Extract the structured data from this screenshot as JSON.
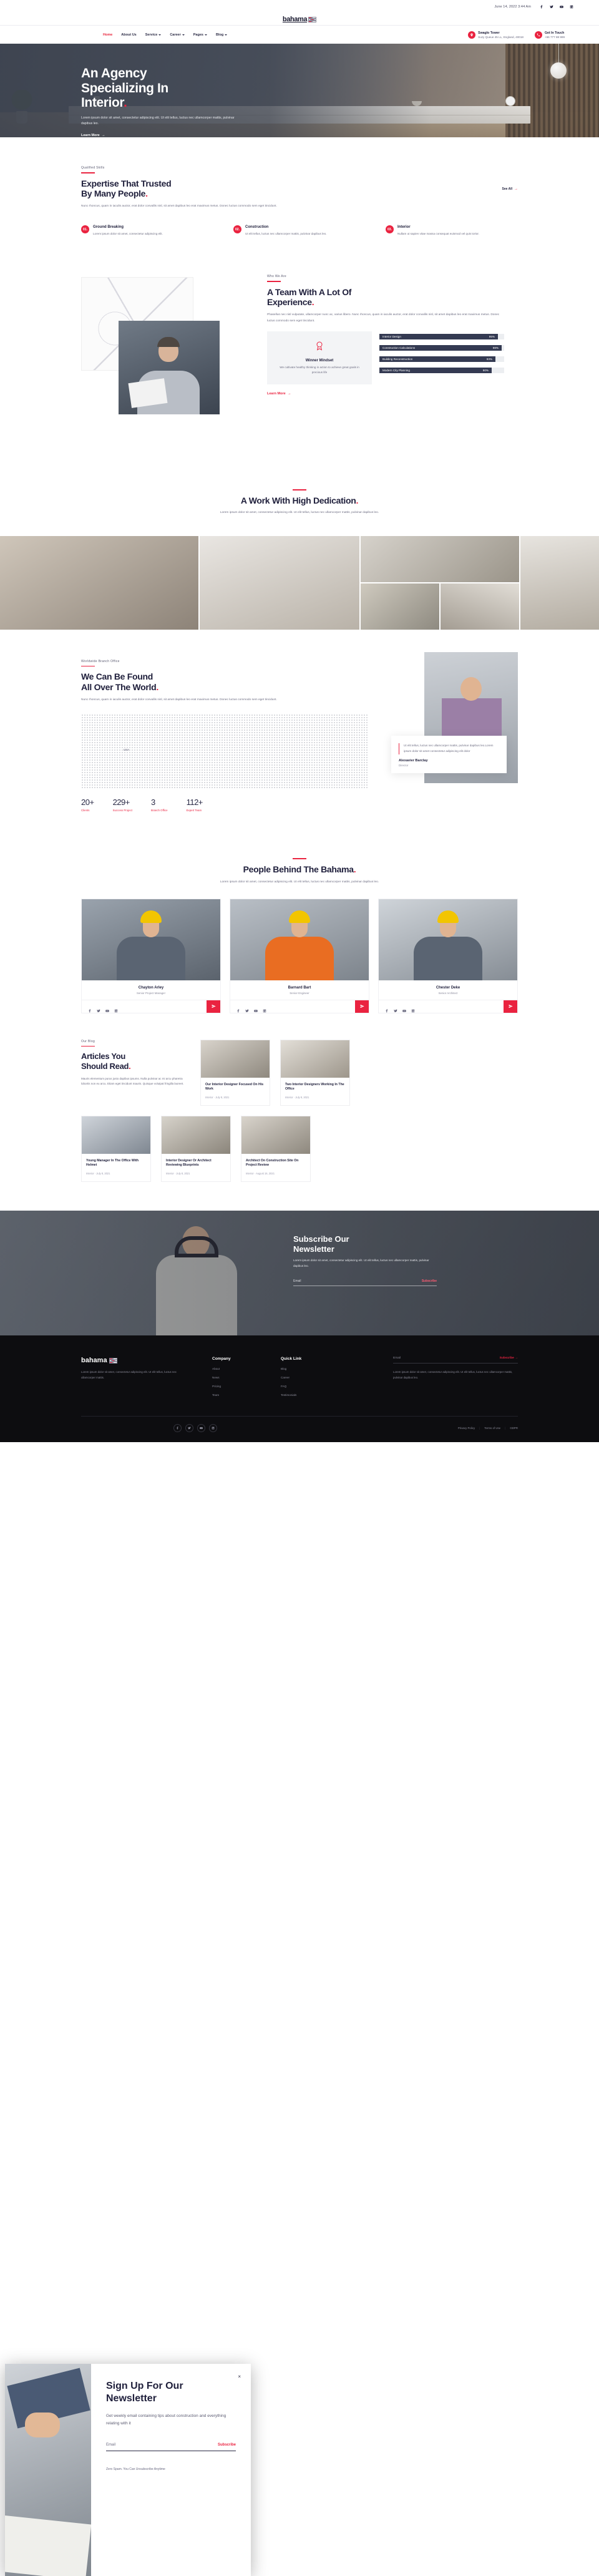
{
  "topbar": {
    "date": "June 14, 2022 3:44 Am",
    "socials": [
      "facebook-icon",
      "twitter-icon",
      "youtube-icon",
      "linkedin-icon"
    ]
  },
  "brand": {
    "name": "bahama",
    "icon": "brick-wall-icon"
  },
  "nav": {
    "items": [
      {
        "label": "Home",
        "active": true,
        "caret": false
      },
      {
        "label": "About Us",
        "active": false,
        "caret": false
      },
      {
        "label": "Service",
        "active": false,
        "caret": true
      },
      {
        "label": "Career",
        "active": false,
        "caret": true
      },
      {
        "label": "Pages",
        "active": false,
        "caret": true
      },
      {
        "label": "Blog",
        "active": false,
        "caret": true
      }
    ],
    "office": {
      "title": "Swaglo Tower",
      "address": "Suzy Queue 45 LL, England, 40018",
      "icon": "location-pin-icon"
    },
    "contact": {
      "title": "Get In Touch",
      "phone": "+66 777 88 999",
      "icon": "phone-icon"
    }
  },
  "hero": {
    "title_line1": "An Agency",
    "title_line2": "Specializing In",
    "title_line3": "Interior",
    "dot": ".",
    "paragraph": "Lorem ipsum dolor sit amet, consectetur adipiscing elit. Ut elit tellus, luctus nec ullamcorper mattis, pulvinar dapibus leo.",
    "cta": "Learn More",
    "arrow": "→"
  },
  "expertise": {
    "eyebrow": "Qualified Skills",
    "title_line1": "Expertise That Trusted",
    "title_line2": "By Many People",
    "dot": ".",
    "paragraph": "Nunc rhoncus, quam in iaculis auctor, erat dolor convallis nisl, sit amet dapibus leo erat maximus metus. Donec luctus commodo sem eget tincidunt.",
    "see_all": "See All",
    "arrow": "→",
    "features": [
      {
        "num": "01.",
        "title": "Ground Breaking",
        "text": "Lorem ipsum dolor sit amet, consectetur adipiscing elit."
      },
      {
        "num": "02.",
        "title": "Construction",
        "text": "Ut elit tellus, luctus nec ullamcorper mattis, pulvinar dapibus leo."
      },
      {
        "num": "03.",
        "title": "Interior",
        "text": "Nullam ut sapien vitae massa consequat euismod vel quis tortor."
      }
    ]
  },
  "whowe": {
    "eyebrow": "Who We Are",
    "title_line1": "A Team With A Lot Of",
    "title_line2": "Experience",
    "dot": ".",
    "paragraph": "Phasellus nec nisl vulputate, ullamcorper nunc ac, varius libero. Nunc rhoncus, quam in iaculis auctor, erat dolor convallis nisl, sit amet dapibus leo erat maximus metus. Donec luctus commodo sem eget tincidunt.",
    "winner": {
      "icon": "award-badge-icon",
      "title": "Winner Mindset",
      "text": "We cultivate healthy thinking in action to achieve great goals in precious life"
    },
    "skills": [
      {
        "label": "Interior Design",
        "value": "95%",
        "pct": 95
      },
      {
        "label": "Construction Calculations",
        "value": "98%",
        "pct": 98
      },
      {
        "label": "Building Reconstruction",
        "value": "93%",
        "pct": 93
      },
      {
        "label": "Modern City Planning",
        "value": "90%",
        "pct": 90
      }
    ],
    "cta": "Learn More",
    "arrow": "→"
  },
  "dedication": {
    "title": "A Work With High Dedication",
    "dot": ".",
    "paragraph": "Lorem ipsum dolor sit amet, consectetur adipiscing elit. Ut elit tellus, luctus nec ullamcorper mattis, pulvinar dapibus leo.",
    "gallery": [
      "living-room-photo",
      "bathroom-photo",
      "kitchen-hall-photo",
      "interior-detail-photo",
      "bedroom-photo",
      "office-interior-photo"
    ]
  },
  "world": {
    "eyebrow": "Worldwide Branch Office",
    "title_line1": "We Can Be Found",
    "title_line2": "All Over The World",
    "dot": ".",
    "paragraph": "Nunc rhoncus, quam in iaculis auctor, erat dolor convallis nisl, sit amet dapibus leo erat maximus metus. Donec luctus commodo sem eget tincidunt.",
    "pin_label": "USA",
    "stats": [
      {
        "value": "20+",
        "label": "Clients"
      },
      {
        "value": "229+",
        "label": "Success Project"
      },
      {
        "value": "3",
        "label": "Branch Office"
      },
      {
        "value": "112+",
        "label": "Expert Team"
      }
    ],
    "quote": {
      "text": "Ut elit tellus, luctus nec ullamcorper mattis, pulvinar dapibus leo.Lorem ipsum dolor sit amet consectetur adipiscing elit dolor",
      "name": "Alexavier Barclay",
      "role": "Director"
    }
  },
  "people": {
    "title": "People Behind The Bahama",
    "dot": ".",
    "paragraph": "Lorem ipsum dolor sit amet, consectetur adipiscing elit. Ut elit tellus, luctus nec ullamcorper mattis, pulvinar dapibus leo.",
    "members": [
      {
        "name": "Chayton Arley",
        "role": "Senior Project Manager",
        "socials": [
          "facebook-icon",
          "twitter-icon",
          "youtube-icon",
          "linkedin-icon"
        ]
      },
      {
        "name": "Barnard Bart",
        "role": "Senior Engineer",
        "socials": [
          "facebook-icon",
          "twitter-icon",
          "youtube-icon",
          "linkedin-icon"
        ]
      },
      {
        "name": "Chester Deke",
        "role": "Senior Architect",
        "socials": [
          "facebook-icon",
          "twitter-icon",
          "youtube-icon",
          "linkedin-icon"
        ]
      }
    ]
  },
  "blog": {
    "eyebrow": "Our Blog",
    "title_line1": "Articles You",
    "title_line2": "Should Read",
    "dot": ".",
    "paragraph": "Mauris elementum purus justo dapibus ipsums. Nulla pulvinar ac mi arcu pharetra lobortis non eu arcu. Etiam eget tincidunt mauris. Quisque volutpat fringilla laoreet.",
    "posts": [
      {
        "title": "Our Interior Designer Focused On His Work",
        "meta": "Interior · July 8, 2021"
      },
      {
        "title": "Two Interior Designers Working In The Office",
        "meta": "Interior · July 8, 2021"
      },
      {
        "title": "Young Manager In The Office With Helmet",
        "meta": "Interior · July 8, 2021"
      },
      {
        "title": "Interior Designer Or Architect Reviewing Blueprints",
        "meta": "Interior · July 8, 2021"
      },
      {
        "title": "Architect On Construction Site On Project Review",
        "meta": "Interior · August 16, 2021"
      }
    ]
  },
  "newsletter_banner": {
    "title_line1": "Subscribe Our",
    "title_line2": "Newsletter",
    "paragraph": "Lorem ipsum dolor sit amet, consectetur adipiscing elit. Ut elit tellus, luctus nec ullamcorper mattis, pulvinar dapibus leo.",
    "email_placeholder": "Email",
    "subscribe": "Subscribe",
    "arrow": "→"
  },
  "footer": {
    "brand": "bahama",
    "about": "Lorem ipsum dolor sit amet, consectetur adipiscing elit. Ut elit tellus, luctus nec ullamcorper mattis.",
    "columns": [
      {
        "heading": "Company",
        "links": [
          "About",
          "News",
          "Pricing",
          "Team"
        ]
      },
      {
        "heading": "Quick Link",
        "links": [
          "Blog",
          "Career",
          "FAQ",
          "Testimonials"
        ]
      }
    ],
    "email_placeholder": "Email",
    "subscribe": "Subscribe",
    "arrow": "→",
    "note": "Lorem ipsum dolor sit amet, consectetur adipiscing elit. Ut elit tellus, luctus nec ullamcorper mattis, pulvinar dapibus leo.",
    "socials": [
      "facebook-icon",
      "twitter-icon",
      "youtube-icon",
      "linkedin-icon"
    ],
    "legal": [
      "Privacy Policy",
      "Terms of Use",
      "GDPR"
    ]
  },
  "popup": {
    "close": "×",
    "title_line1": "Sign Up For Our",
    "title_line2": "Newsletter",
    "paragraph": "Get weekly email containing tips about construction and everything relating with it",
    "email_placeholder": "Email",
    "subscribe": "Subscribe",
    "arrow": "→",
    "note": "Zero Spam. You Can Unsubscribe Anytime"
  },
  "colors": {
    "accent": "#ea2340",
    "ink": "#20203c",
    "dark_footer": "#0d0d10"
  }
}
